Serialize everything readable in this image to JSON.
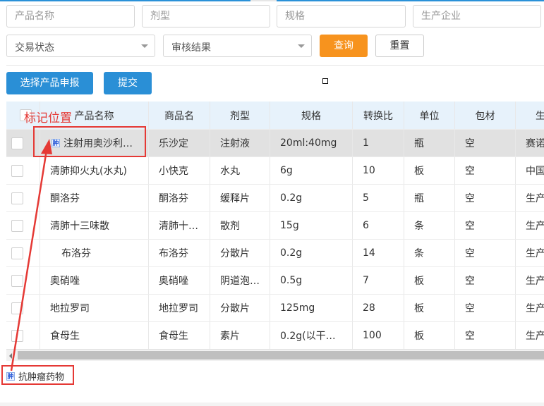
{
  "filters": {
    "product_name_placeholder": "产品名称",
    "dosage_form_placeholder": "剂型",
    "spec_placeholder": "规格",
    "manufacturer_placeholder": "生产企业",
    "trade_status": "交易状态",
    "review_result": "审核结果",
    "query_label": "查询",
    "reset_label": "重置"
  },
  "actions": {
    "select_apply_label": "选择产品申报",
    "submit_label": "提交"
  },
  "annotation": {
    "marker_label": "标记位置",
    "tag_text": "抗肿瘤药物",
    "tag_icon_text": "肿",
    "color": "#e53935"
  },
  "table": {
    "columns": [
      "产品名称",
      "商品名",
      "剂型",
      "规格",
      "转换比",
      "单位",
      "包材",
      "生"
    ],
    "rows": [
      {
        "name": "注射用奥沙利…",
        "trade": "乐沙定",
        "form": "注射液",
        "spec": "20ml:40mg",
        "ratio": "1",
        "unit": "瓶",
        "pack": "空",
        "mfr": "赛诺"
      },
      {
        "name": "清肺抑火丸(水丸)",
        "trade": "小快克",
        "form": "水丸",
        "spec": "6g",
        "ratio": "10",
        "unit": "板",
        "pack": "空",
        "mfr": "中国"
      },
      {
        "name": "酮洛芬",
        "trade": "酮洛芬",
        "form": "缓释片",
        "spec": "0.2g",
        "ratio": "5",
        "unit": "瓶",
        "pack": "空",
        "mfr": "生产"
      },
      {
        "name": "清肺十三味散",
        "trade": "清肺十…",
        "form": "散剂",
        "spec": "15g",
        "ratio": "6",
        "unit": "条",
        "pack": "空",
        "mfr": "生产"
      },
      {
        "name": "布洛芬",
        "trade": "布洛芬",
        "form": "分散片",
        "spec": "0.2g",
        "ratio": "14",
        "unit": "条",
        "pack": "空",
        "mfr": "生产"
      },
      {
        "name": "奥硝唑",
        "trade": "奥硝唑",
        "form": "阴道泡…",
        "spec": "0.5g",
        "ratio": "7",
        "unit": "板",
        "pack": "空",
        "mfr": "生产"
      },
      {
        "name": "地拉罗司",
        "trade": "地拉罗司",
        "form": "分散片",
        "spec": "125mg",
        "ratio": "28",
        "unit": "板",
        "pack": "空",
        "mfr": "生产"
      },
      {
        "name": "食母生",
        "trade": "食母生",
        "form": "素片",
        "spec": "0.2g(以干…",
        "ratio": "100",
        "unit": "板",
        "pack": "空",
        "mfr": "生产"
      }
    ]
  },
  "colors": {
    "accent_blue": "#2a8fd6",
    "query_orange": "#f7931e",
    "header_bg": "#e7f2fb",
    "selected_row_bg": "#e1e1e1"
  }
}
